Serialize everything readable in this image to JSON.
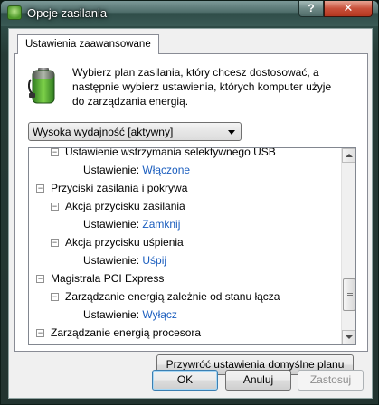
{
  "window": {
    "title": "Opcje zasilania",
    "help_label": "?",
    "close_label": "✕"
  },
  "tab": {
    "label": "Ustawienia zaawansowane"
  },
  "description": "Wybierz plan zasilania, który chcesz dostosować, a następnie wybierz ustawienia, których komputer użyje do zarządzania energią.",
  "plan": {
    "selected": "Wysoka wydajność [aktywny]"
  },
  "tree": {
    "value_label": "Ustawienie:",
    "rows": [
      {
        "kind": "node",
        "level": 1,
        "expander": "⊟",
        "label": "Ustawienie wstrzymania selektywnego USB"
      },
      {
        "kind": "value",
        "level": 2,
        "value": "Włączone"
      },
      {
        "kind": "node",
        "level": 0,
        "expander": "⊟",
        "label": "Przyciski zasilania i pokrywa"
      },
      {
        "kind": "node",
        "level": 1,
        "expander": "⊟",
        "label": "Akcja przycisku zasilania"
      },
      {
        "kind": "value",
        "level": 2,
        "value": "Zamknij"
      },
      {
        "kind": "node",
        "level": 1,
        "expander": "⊟",
        "label": "Akcja przycisku uśpienia"
      },
      {
        "kind": "value",
        "level": 2,
        "value": "Uśpij"
      },
      {
        "kind": "node",
        "level": 0,
        "expander": "⊟",
        "label": "Magistrala PCI Express"
      },
      {
        "kind": "node",
        "level": 1,
        "expander": "⊟",
        "label": "Zarządzanie energią zależnie od stanu łącza"
      },
      {
        "kind": "value",
        "level": 2,
        "value": "Wyłącz"
      },
      {
        "kind": "node",
        "level": 0,
        "expander": "⊟",
        "label": "Zarządzanie energią procesora"
      }
    ]
  },
  "buttons": {
    "restore": "Przywróć ustawienia domyślne planu",
    "ok": "OK",
    "cancel": "Anuluj",
    "apply": "Zastosuj"
  },
  "colors": {
    "link_value": "#1a5dbe",
    "close_button": "#c9503a"
  }
}
